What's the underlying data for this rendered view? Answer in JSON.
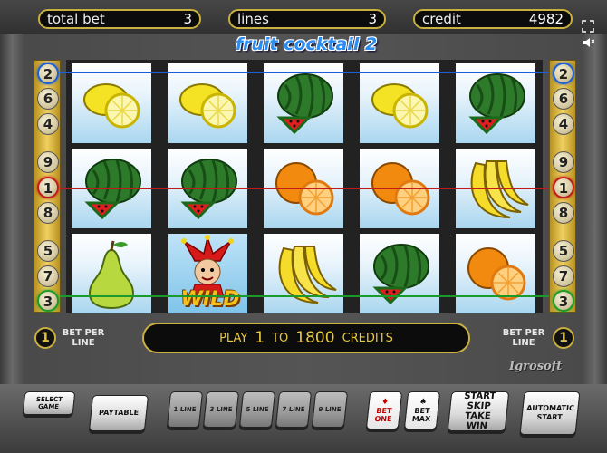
{
  "meters": {
    "total_bet_label": "total bet",
    "total_bet_value": "3",
    "lines_label": "lines",
    "lines_value": "3",
    "credit_label": "credit",
    "credit_value": "4982"
  },
  "title": "fruit cocktail 2",
  "line_numbers_left": [
    "2",
    "6",
    "4",
    "9",
    "1",
    "8",
    "5",
    "7",
    "3"
  ],
  "line_numbers_right": [
    "2",
    "6",
    "4",
    "9",
    "1",
    "8",
    "5",
    "7",
    "3"
  ],
  "reels": [
    [
      "lemon",
      "watermelon",
      "pear"
    ],
    [
      "lemon",
      "watermelon",
      "joker-wild"
    ],
    [
      "watermelon",
      "orange",
      "banana"
    ],
    [
      "lemon",
      "orange",
      "watermelon"
    ],
    [
      "watermelon",
      "banana",
      "orange"
    ]
  ],
  "wild_label": "WILD",
  "colors": {
    "line_blue": "#1a5fd8",
    "line_red": "#c21a1a",
    "line_green": "#1a9a2a",
    "gold": "#c9b040"
  },
  "panel": {
    "bet_per_line_left": "BET PER LINE",
    "bet_per_line_left_value": "1",
    "bet_per_line_right": "BET PER LINE",
    "bet_per_line_right_value": "1",
    "play": "PLAY",
    "play_from": "1",
    "to": "TO",
    "play_to": "1800",
    "credits": "CREDITS"
  },
  "brand": "Igrosoft",
  "buttons": {
    "select_game": "SELECT GAME",
    "paytable": "PAYTABLE",
    "line1": "1 LINE",
    "line3": "3 LINE",
    "line5": "5 LINE",
    "line7": "7 LINE",
    "line9": "9 LINE",
    "bet_one": "BET ONE",
    "bet_max": "BET MAX",
    "start_skip_take": "START SKIP TAKE WIN",
    "automatic_start": "AUTOMATIC START"
  }
}
